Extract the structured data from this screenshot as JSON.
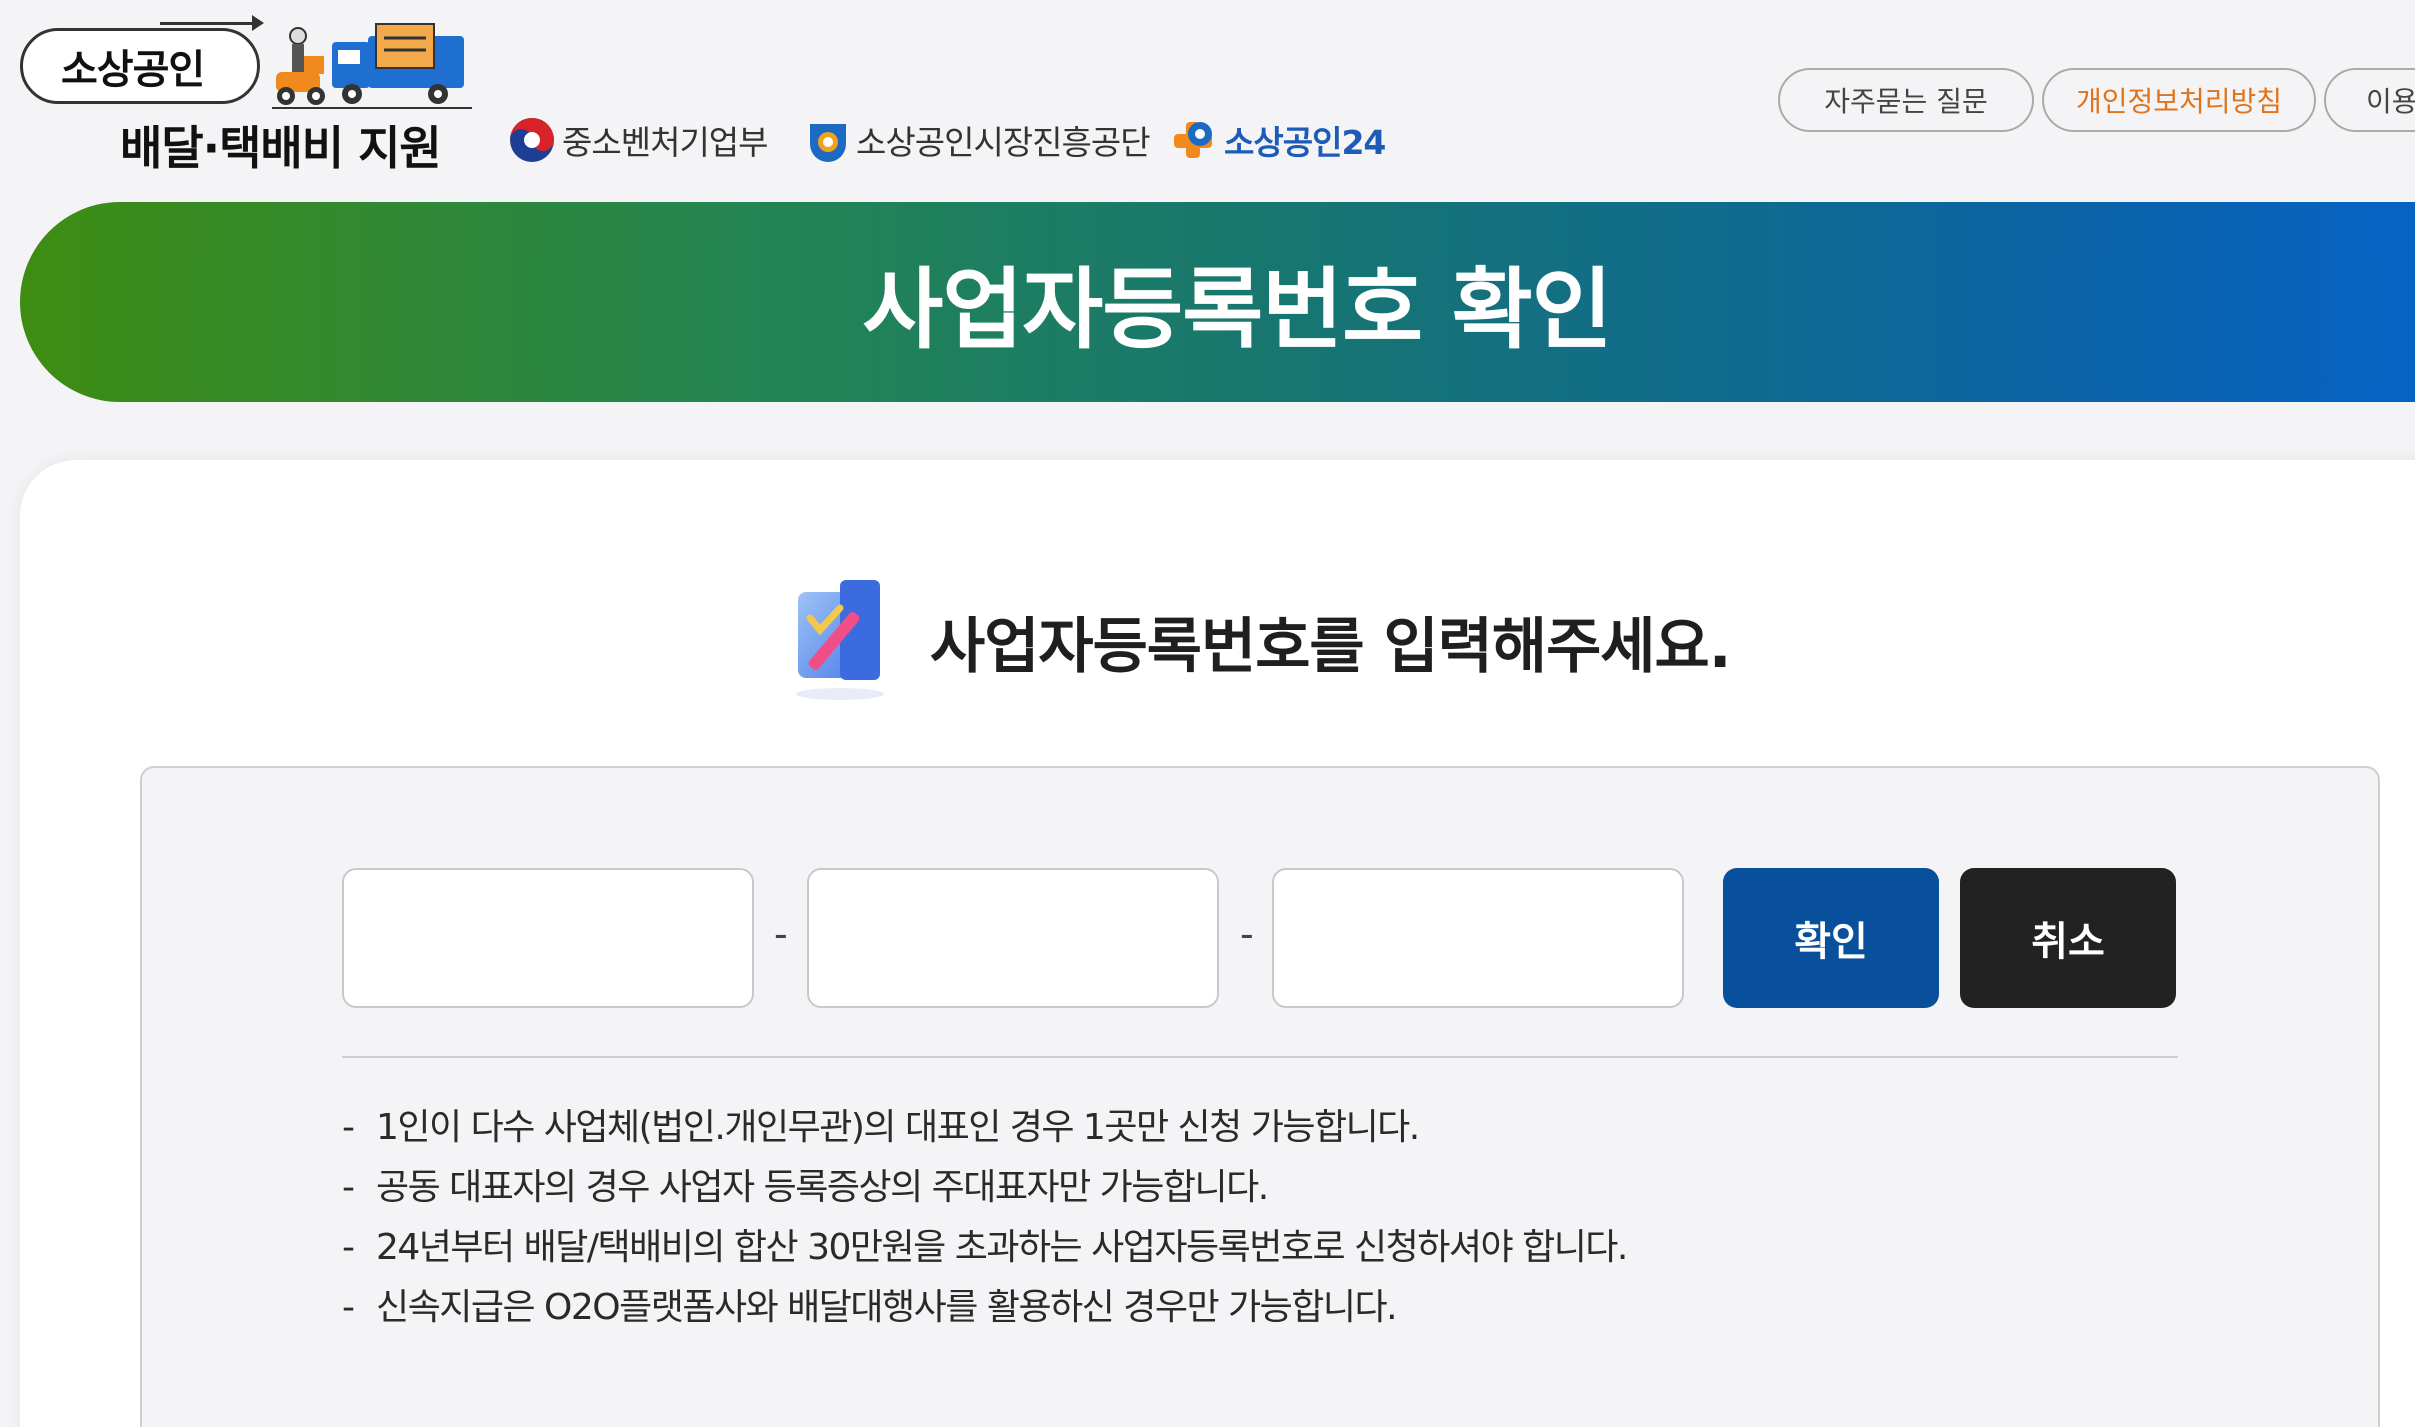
{
  "logo": {
    "top_text": "소상공인",
    "bottom_text": "배달·택배비 지원"
  },
  "partners": [
    {
      "name": "중소벤처기업부",
      "icon": "taegeuk-emblem-icon"
    },
    {
      "name": "소상공인시장진흥공단",
      "icon": "semas-logo-icon"
    },
    {
      "name": "소상공인24",
      "icon": "sbiz24-logo-icon"
    }
  ],
  "nav": {
    "faq": "자주묻는 질문",
    "privacy": "개인정보처리방침",
    "terms": "이용약관"
  },
  "banner": {
    "title": "사업자등록번호 확인"
  },
  "form": {
    "prompt": "사업자등록번호를 입력해주세요.",
    "prompt_icon": "checklist-pencil-icon",
    "field1_value": "",
    "field2_value": "",
    "field3_value": "",
    "separator": "-",
    "confirm_label": "확인",
    "cancel_label": "취소"
  },
  "notes": [
    "1인이 다수 사업체(법인.개인무관)의 대표인 경우 1곳만 신청 가능합니다.",
    "공동 대표자의 경우 사업자 등록증상의 주대표자만 가능합니다.",
    "24년부터 배달/택배비의 합산 30만원을 초과하는 사업자등록번호로 신청하셔야 합니다.",
    "신속지급은 O2O플랫폼사와 배달대행사를 활용하신 경우만 가능합니다."
  ],
  "note_bullet": "-",
  "colors": {
    "confirm_button": "#084f9c",
    "cancel_button": "#222222",
    "banner_start": "#3e8c12",
    "banner_end": "#0563c7",
    "privacy_link": "#e0731c"
  }
}
